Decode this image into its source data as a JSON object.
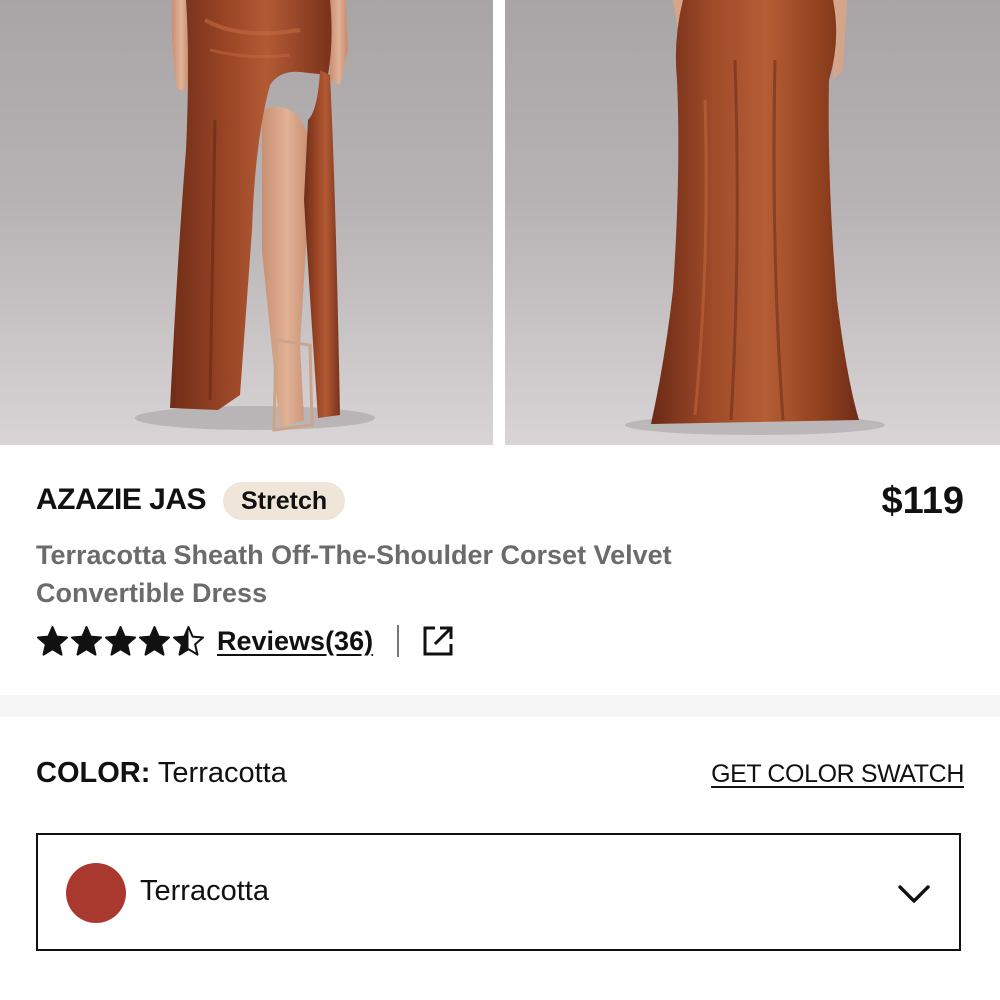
{
  "gallery": {
    "images": [
      {
        "icon": "dress-front-photo"
      },
      {
        "icon": "dress-back-photo"
      }
    ]
  },
  "product": {
    "brand": "AZAZIE JAS",
    "badge": "Stretch",
    "price": "$119",
    "title": "Terracotta Sheath Off-The-Shoulder Corset Velvet Convertible Dress",
    "rating": 4.5,
    "reviews_label": "Reviews(36)",
    "share_icon": "share-external-icon"
  },
  "color": {
    "label": "COLOR:",
    "selected": "Terracotta",
    "swatch_link": "GET COLOR SWATCH",
    "dropdown_value": "Terracotta",
    "swatch_color": "#a9382f"
  },
  "colors": {
    "badge_bg": "#efe5d8",
    "velvet": "#8e3e22",
    "text_muted": "#6b6b6b"
  }
}
